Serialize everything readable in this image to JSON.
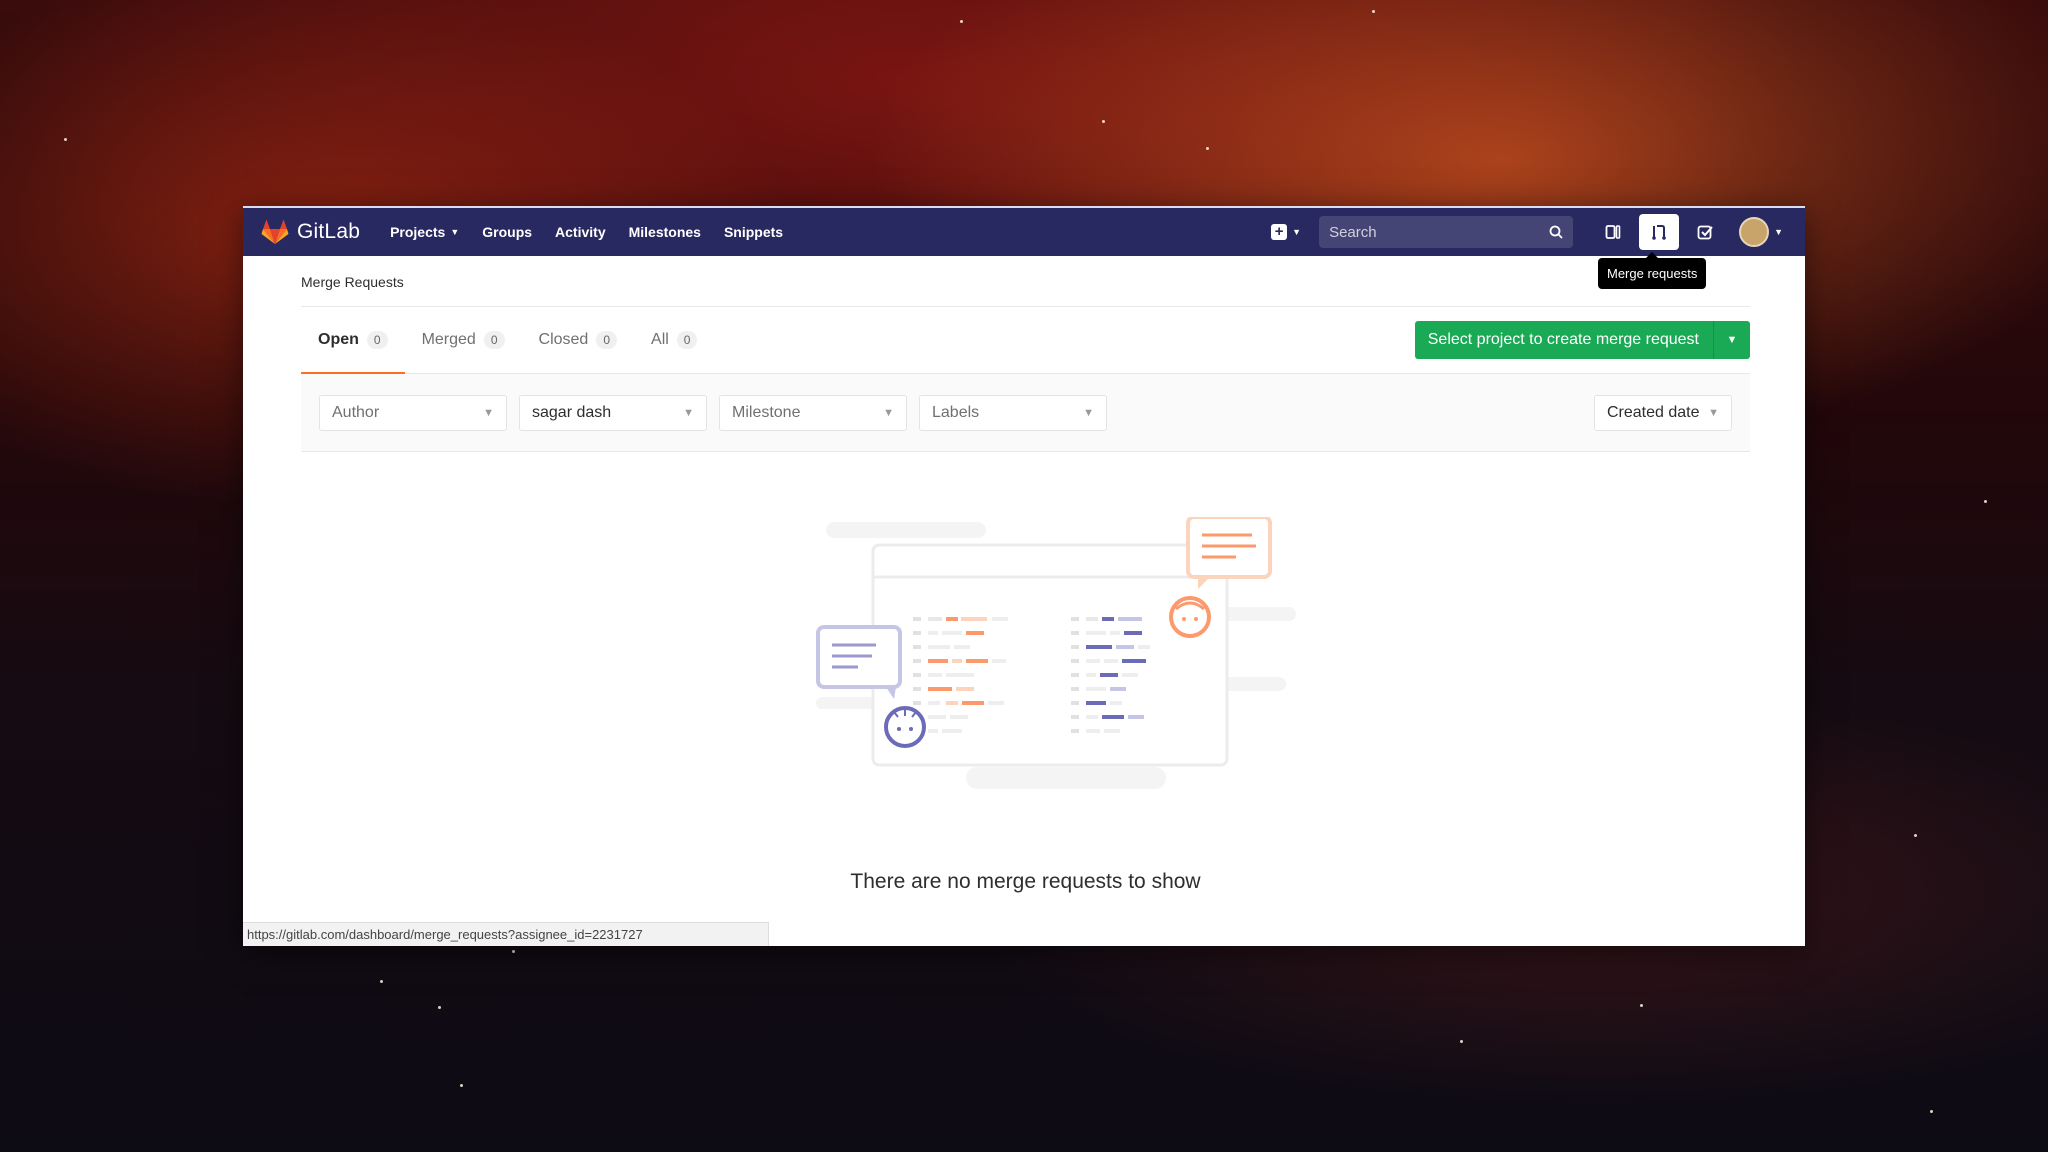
{
  "app": {
    "name": "GitLab"
  },
  "topnav": {
    "links": [
      {
        "label": "Projects",
        "has_caret": true
      },
      {
        "label": "Groups"
      },
      {
        "label": "Activity"
      },
      {
        "label": "Milestones"
      },
      {
        "label": "Snippets"
      }
    ],
    "search_placeholder": "Search",
    "icons": [
      "plus-square-icon",
      "search-icon",
      "issues-icon",
      "merge-request-icon",
      "todo-icon",
      "avatar"
    ],
    "tooltip": "Merge requests"
  },
  "breadcrumb": "Merge Requests",
  "tabs": [
    {
      "label": "Open",
      "count": "0",
      "active": true
    },
    {
      "label": "Merged",
      "count": "0"
    },
    {
      "label": "Closed",
      "count": "0"
    },
    {
      "label": "All",
      "count": "0"
    }
  ],
  "create_button": {
    "label": "Select project to create merge request",
    "color": "#1aaa55"
  },
  "filters": {
    "author": "Author",
    "assignee": "sagar dash",
    "milestone": "Milestone",
    "labels": "Labels",
    "sort": "Created date"
  },
  "empty_state": {
    "message": "There are no merge requests to show"
  },
  "status_url": "https://gitlab.com/dashboard/merge_requests?assignee_id=2231727",
  "colors": {
    "nav": "#292961",
    "accent": "#fc6d26",
    "success": "#1aaa55"
  }
}
